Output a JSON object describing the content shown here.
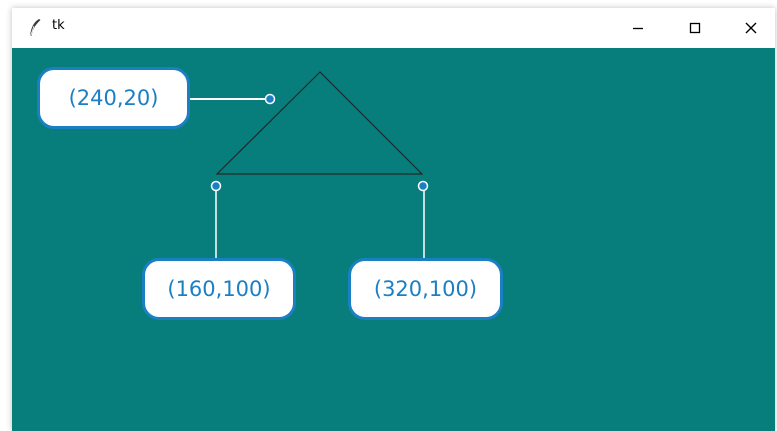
{
  "window": {
    "title": "tk",
    "controls": {
      "minimize": "minimize",
      "maximize": "maximize",
      "close": "close"
    }
  },
  "canvas": {
    "background": "#087e7c",
    "shape": "triangle",
    "points": [
      {
        "label": "(240,20)"
      },
      {
        "label": "(160,100)"
      },
      {
        "label": "(320,100)"
      }
    ]
  },
  "colors": {
    "annotation": "#1b7fc3",
    "outline": "#1e2b2b",
    "leader": "#ffffff"
  },
  "icons": {
    "app": "feather-icon"
  }
}
